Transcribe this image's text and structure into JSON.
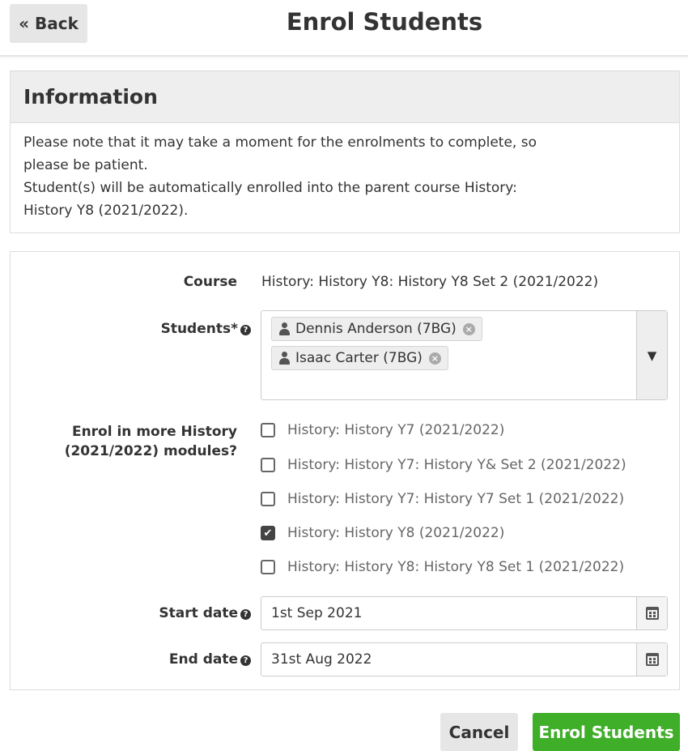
{
  "header": {
    "back_label": "« Back",
    "title": "Enrol Students"
  },
  "info": {
    "heading": "Information",
    "line1": "Please note that it may take a moment for the enrolments to complete, so please be patient.",
    "line2": "Student(s) will be automatically enrolled into the parent course History: History Y8 (2021/2022)."
  },
  "form": {
    "course_label": "Course",
    "course_value": "History: History Y8: History Y8 Set 2 (2021/2022)",
    "students_label": "Students*",
    "students": [
      {
        "name": "Dennis Anderson (7BG)"
      },
      {
        "name": "Isaac Carter (7BG)"
      }
    ],
    "modules_label_line1": "Enrol in more History",
    "modules_label_line2": "(2021/2022) modules?",
    "modules": [
      {
        "label": "History: History Y7 (2021/2022)",
        "checked": false
      },
      {
        "label": "History: History Y7: History Y& Set 2 (2021/2022)",
        "checked": false
      },
      {
        "label": "History: History Y7: History Y7 Set 1 (2021/2022)",
        "checked": false
      },
      {
        "label": "History: History Y8 (2021/2022)",
        "checked": true
      },
      {
        "label": "History: History Y8: History Y8 Set 1 (2021/2022)",
        "checked": false
      }
    ],
    "start_date_label": "Start date",
    "start_date_value": "1st Sep 2021",
    "end_date_label": "End date",
    "end_date_value": "31st Aug 2022"
  },
  "footer": {
    "cancel_label": "Cancel",
    "enrol_label": "Enrol Students"
  },
  "colors": {
    "primary_green": "#3fae29",
    "button_grey": "#e6e6e6",
    "panel_header": "#eeeeee"
  },
  "icons": {
    "help": "question-circle-icon",
    "user": "user-icon",
    "remove": "remove-circle-icon",
    "dropdown": "caret-down-icon",
    "calendar": "calendar-icon",
    "check": "checkmark-icon"
  }
}
